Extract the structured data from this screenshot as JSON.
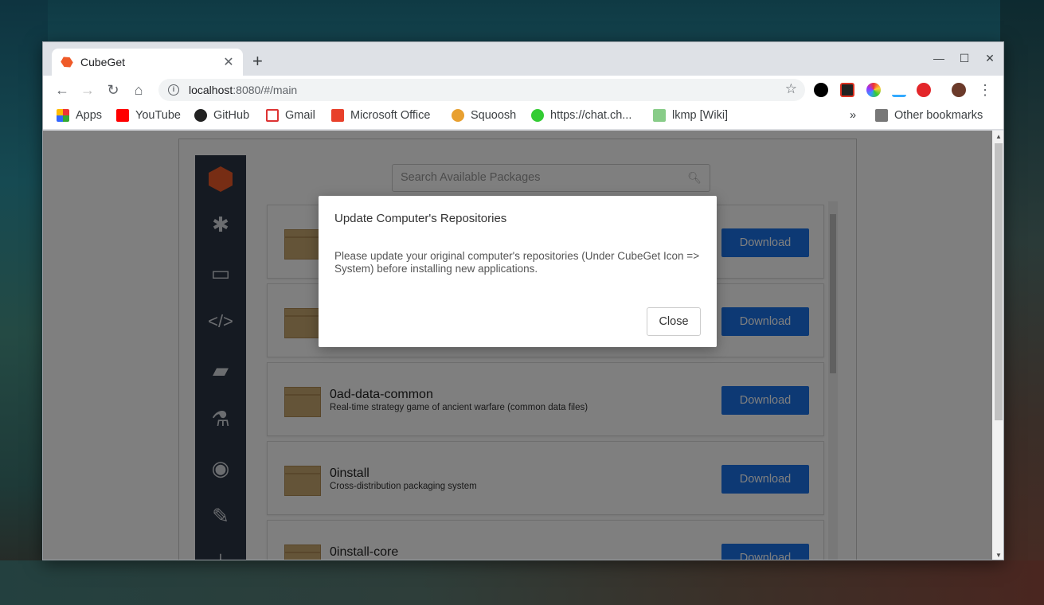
{
  "browser": {
    "tab_title": "CubeGet",
    "tab_close": "✕",
    "new_tab": "+",
    "url_host": "localhost",
    "url_path": ":8080/#/main",
    "minimize": "—",
    "maximize": "☐",
    "close": "✕"
  },
  "bookmarks": {
    "items": [
      "Apps",
      "YouTube",
      "GitHub",
      "Gmail",
      "Microsoft Office",
      "Squoosh",
      "https://chat.ch...",
      "lkmp [Wiki]"
    ],
    "overflow": "»",
    "other": "Other bookmarks"
  },
  "app": {
    "search_placeholder": "Search Available Packages",
    "packages": [
      {
        "name": "",
        "description": "",
        "action": "Download"
      },
      {
        "name": "",
        "description": "",
        "action": "Download"
      },
      {
        "name": "0ad-data-common",
        "description": "Real-time strategy game of ancient warfare (common data files)",
        "action": "Download"
      },
      {
        "name": "0install",
        "description": "Cross-distribution packaging system",
        "action": "Download"
      },
      {
        "name": "0install-core",
        "description": "",
        "action": "Download"
      }
    ]
  },
  "modal": {
    "title": "Update Computer's Repositories",
    "body": "Please update your original computer's repositories (Under CubeGet Icon => System) before installing new applications.",
    "close_label": "Close"
  }
}
